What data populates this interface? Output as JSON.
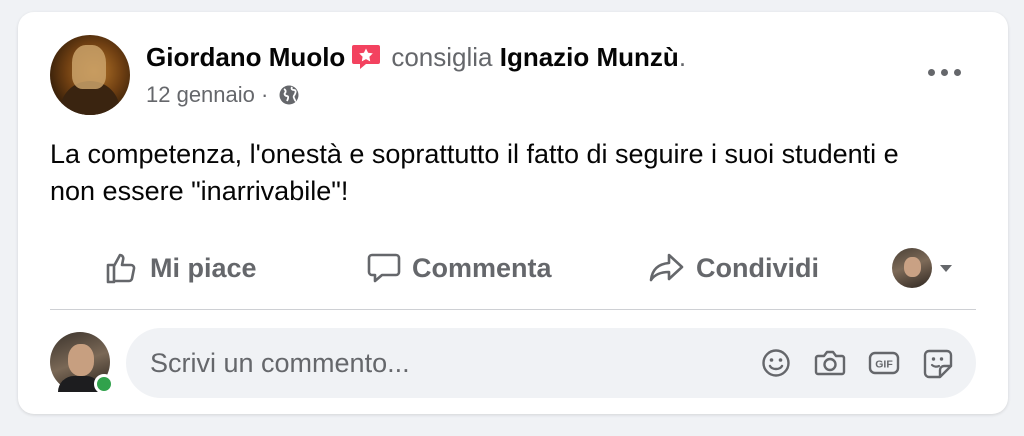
{
  "post": {
    "author": "Giordano Muolo",
    "verb": "consiglia",
    "target": "Ignazio Munzù",
    "period": ".",
    "date": "12 gennaio",
    "separator": " · ",
    "text": "La competenza, l'onestà e soprattutto il fatto di seguire i suoi studenti e non essere \"inarrivabile\"!"
  },
  "actions": {
    "like": "Mi piace",
    "comment": "Commenta",
    "share": "Condividi"
  },
  "composer": {
    "placeholder": "Scrivi un commento..."
  },
  "icons": {
    "badge": "recommend-badge-icon",
    "privacy": "globe-icon",
    "more": "more-icon",
    "like": "thumbs-up-icon",
    "comment": "comment-bubble-icon",
    "share": "share-arrow-icon",
    "emoji": "emoji-icon",
    "camera": "camera-icon",
    "gif": "gif-icon",
    "sticker": "sticker-icon"
  },
  "colors": {
    "badge": "#f3425f",
    "online": "#31a24c",
    "secondary_text": "#65676b"
  }
}
